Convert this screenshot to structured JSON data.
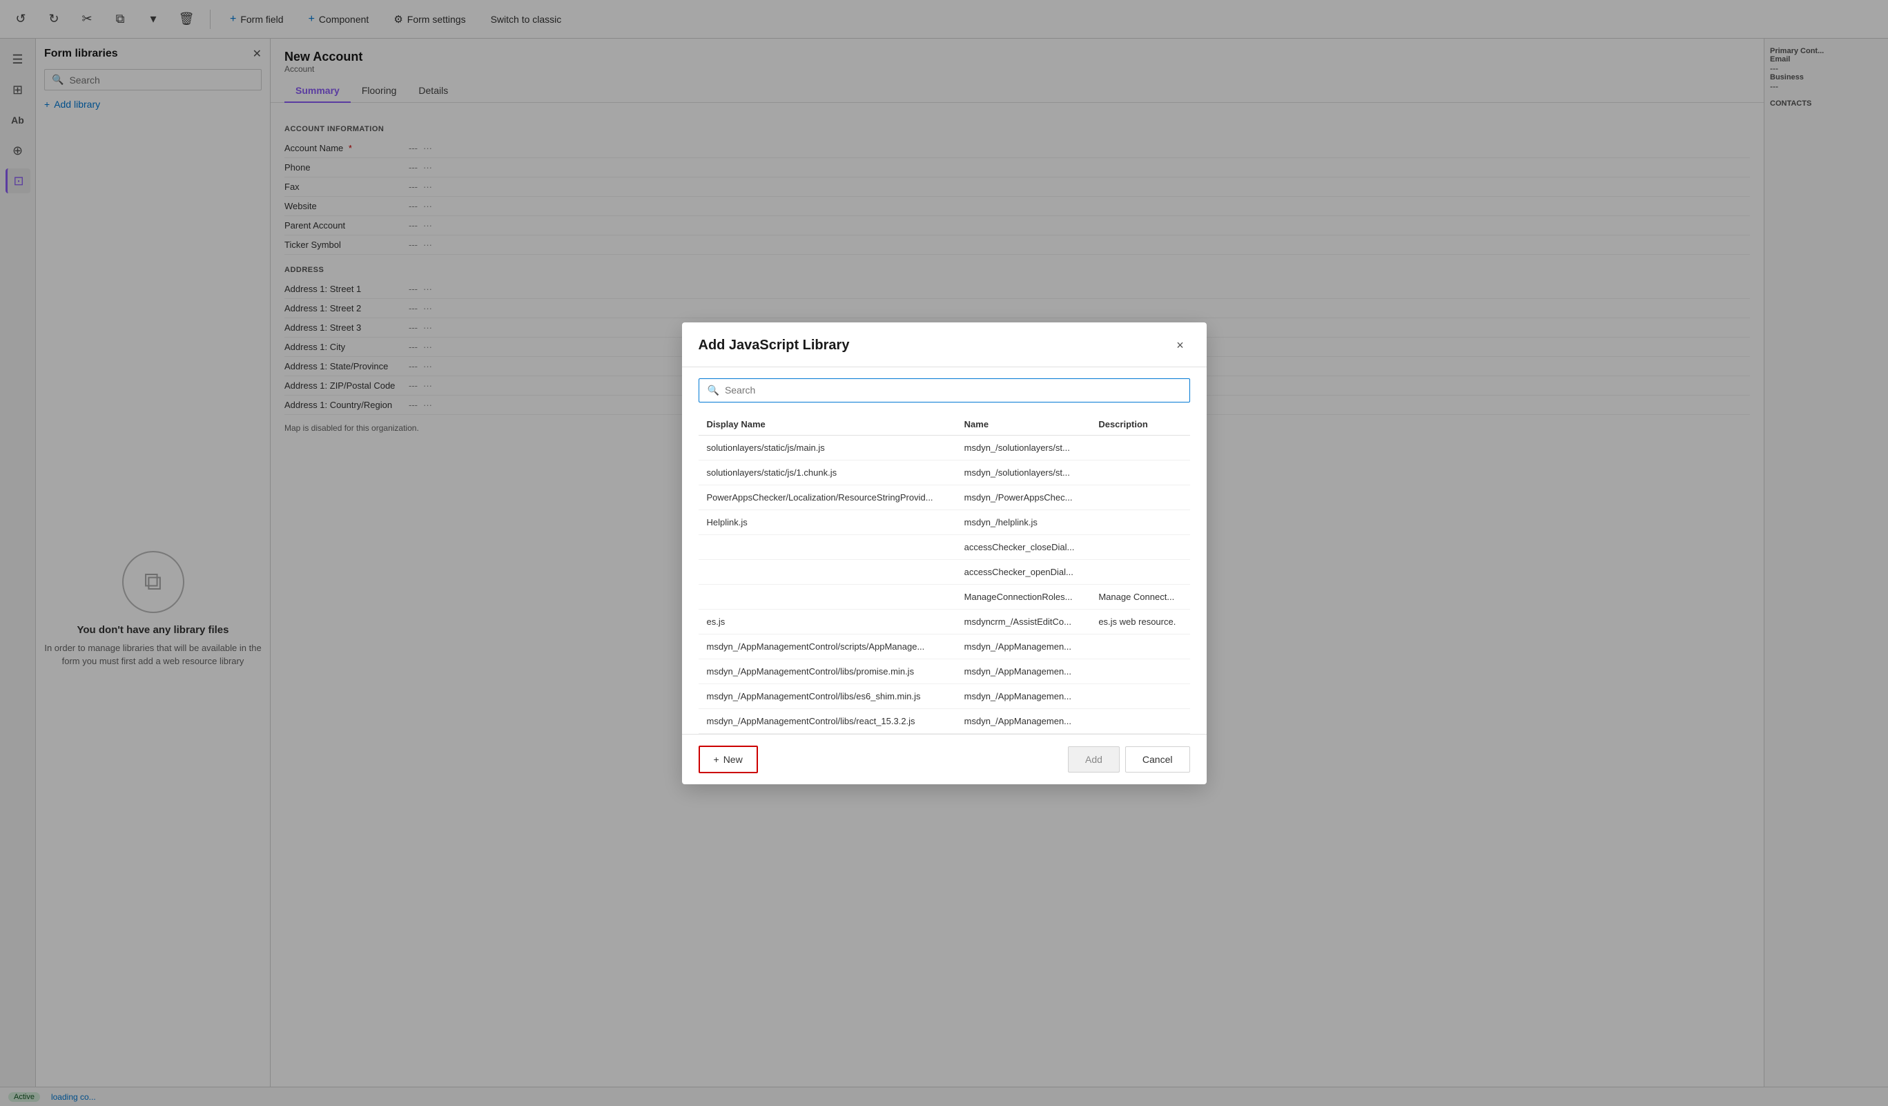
{
  "toolbar": {
    "form_field_label": "Form field",
    "component_label": "Component",
    "form_settings_label": "Form settings",
    "switch_label": "Switch to classic"
  },
  "sidebar": {
    "title": "Form libraries",
    "search_placeholder": "Search",
    "add_library_label": "Add library",
    "empty_title": "You don't have any library files",
    "empty_desc": "In order to manage libraries that will be available in the form you must first add a web resource library"
  },
  "form": {
    "title": "New Account",
    "subtitle": "Account",
    "tabs": [
      {
        "label": "Summary",
        "active": true
      },
      {
        "label": "Flooring",
        "active": false
      },
      {
        "label": "Details",
        "active": false
      }
    ],
    "account_info_section": "ACCOUNT INFORMATION",
    "fields": [
      {
        "label": "Account Name",
        "required": true,
        "value": "---"
      },
      {
        "label": "Phone",
        "required": false,
        "value": "---"
      },
      {
        "label": "Fax",
        "required": false,
        "value": "---"
      },
      {
        "label": "Website",
        "required": false,
        "value": "---"
      },
      {
        "label": "Parent Account",
        "required": false,
        "value": "---"
      },
      {
        "label": "Ticker Symbol",
        "required": false,
        "value": "---"
      }
    ],
    "address_section": "ADDRESS",
    "address_fields": [
      {
        "label": "Address 1: Street 1",
        "value": "---"
      },
      {
        "label": "Address 1: Street 2",
        "value": "---"
      },
      {
        "label": "Address 1: Street 3",
        "value": "---"
      },
      {
        "label": "Address 1: City",
        "value": "---"
      },
      {
        "label": "Address 1: State/Province",
        "value": "---"
      },
      {
        "label": "Address 1: ZIP/Postal Code",
        "value": "---"
      },
      {
        "label": "Address 1: Country/Region",
        "value": "---"
      }
    ],
    "map_notice": "Map is disabled for this organization.",
    "status": "Active"
  },
  "right_panel": {
    "primary_contact_label": "Primary Cont...",
    "email_label": "Email",
    "email_value": "---",
    "business_label": "Business",
    "business_value": "---",
    "contacts_label": "CONTACTS"
  },
  "modal": {
    "title": "Add JavaScript Library",
    "search_placeholder": "Search",
    "close_label": "×",
    "columns": {
      "display_name": "Display Name",
      "name": "Name",
      "description": "Description"
    },
    "rows": [
      {
        "display_name": "solutionlayers/static/js/main.js",
        "name": "msdyn_/solutionlayers/st...",
        "description": ""
      },
      {
        "display_name": "solutionlayers/static/js/1.chunk.js",
        "name": "msdyn_/solutionlayers/st...",
        "description": ""
      },
      {
        "display_name": "PowerAppsChecker/Localization/ResourceStringProvid...",
        "name": "msdyn_/PowerAppsChec...",
        "description": ""
      },
      {
        "display_name": "Helplink.js",
        "name": "msdyn_/helplink.js",
        "description": ""
      },
      {
        "display_name": "",
        "name": "accessChecker_closeDial...",
        "description": ""
      },
      {
        "display_name": "",
        "name": "accessChecker_openDial...",
        "description": ""
      },
      {
        "display_name": "",
        "name": "ManageConnectionRoles...",
        "description": "Manage Connect..."
      },
      {
        "display_name": "es.js",
        "name": "msdyncrm_/AssistEditCo...",
        "description": "es.js web resource."
      },
      {
        "display_name": "msdyn_/AppManagementControl/scripts/AppManage...",
        "name": "msdyn_/AppManagemen...",
        "description": ""
      },
      {
        "display_name": "msdyn_/AppManagementControl/libs/promise.min.js",
        "name": "msdyn_/AppManagemen...",
        "description": ""
      },
      {
        "display_name": "msdyn_/AppManagementControl/libs/es6_shim.min.js",
        "name": "msdyn_/AppManagemen...",
        "description": ""
      },
      {
        "display_name": "msdyn_/AppManagementControl/libs/react_15.3.2.js",
        "name": "msdyn_/AppManagemen...",
        "description": ""
      }
    ],
    "new_button_label": "New",
    "add_button_label": "Add",
    "cancel_button_label": "Cancel"
  }
}
